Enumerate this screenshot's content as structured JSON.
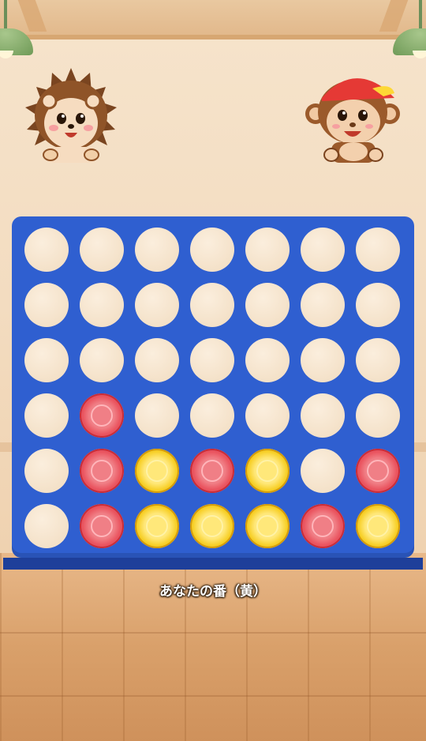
{
  "status_text": "あなたの番（黄）",
  "players": {
    "left": {
      "character": "hedgehog"
    },
    "right": {
      "character": "monkey-red-cap"
    }
  },
  "colors": {
    "board": "#2f5fd0",
    "red_disc": "#ea5560",
    "yellow_disc": "#f7cf26"
  },
  "board": {
    "columns": 7,
    "rows": 6,
    "cells": [
      [
        "",
        "",
        "",
        "",
        "",
        "",
        ""
      ],
      [
        "",
        "",
        "",
        "",
        "",
        "",
        ""
      ],
      [
        "",
        "",
        "",
        "",
        "",
        "",
        ""
      ],
      [
        "",
        "red",
        "",
        "",
        "",
        "",
        ""
      ],
      [
        "",
        "red",
        "yellow",
        "red",
        "yellow",
        "",
        "red"
      ],
      [
        "",
        "red",
        "yellow",
        "yellow",
        "yellow",
        "red",
        "yellow"
      ]
    ]
  }
}
